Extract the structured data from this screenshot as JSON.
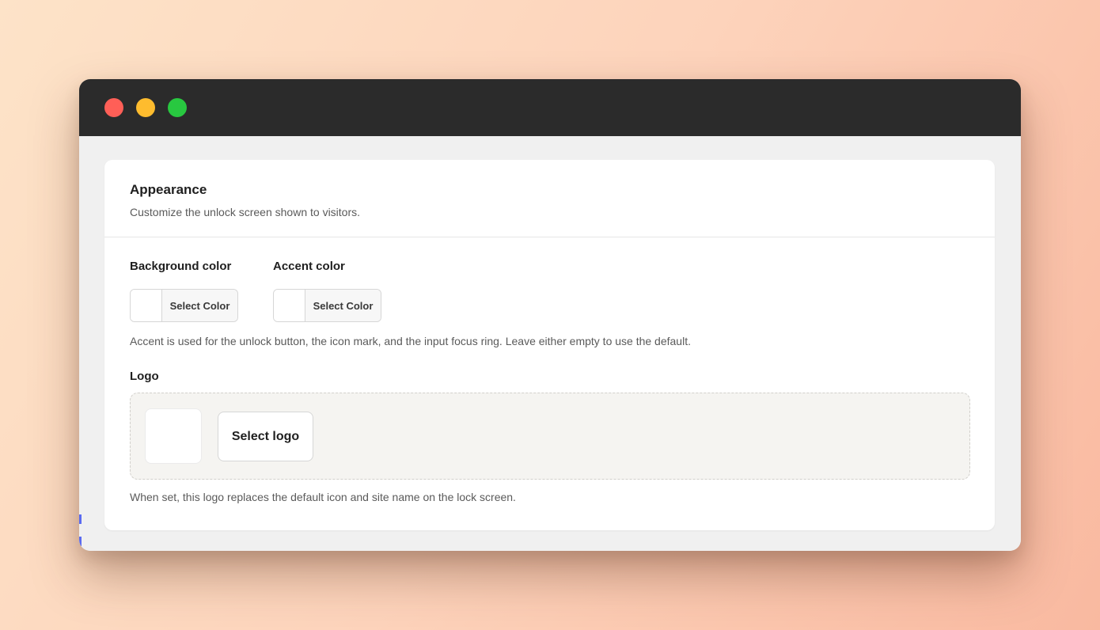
{
  "window": {
    "controls": [
      "close",
      "minimize",
      "maximize"
    ]
  },
  "appearance": {
    "title": "Appearance",
    "subtitle": "Customize the unlock screen shown to visitors."
  },
  "colors": {
    "background": {
      "label": "Background color",
      "button_label": "Select Color",
      "value": "#ffffff"
    },
    "accent": {
      "label": "Accent color",
      "button_label": "Select Color",
      "value": "#ffffff"
    },
    "help": "Accent is used for the unlock button, the icon mark, and the input focus ring. Leave either empty to use the default."
  },
  "logo": {
    "label": "Logo",
    "button_label": "Select logo",
    "help": "When set, this logo replaces the default icon and site name on the lock screen."
  },
  "theme": {
    "titlebar": "#2b2b2b",
    "close": "#ff5f57",
    "minimize": "#febc2e",
    "maximize": "#28c840"
  }
}
